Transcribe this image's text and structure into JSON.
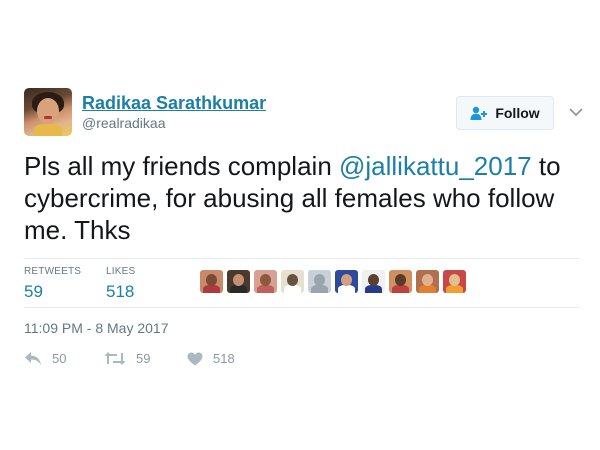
{
  "user": {
    "display_name": "Radikaa Sarathkumar",
    "screen_name": "@realradikaa"
  },
  "follow_button": {
    "label": "Follow",
    "icon": "follow-person-icon"
  },
  "more_menu": {
    "icon": "chevron-down-icon"
  },
  "tweet": {
    "line1_prefix": "Pls all my friends complain ",
    "mention": "@jallikattu_2017",
    "rest": " to cybercrime, for abusing all females who follow me. Thks"
  },
  "stats": {
    "retweets_label": "RETWEETS",
    "retweets_value": "59",
    "likes_label": "LIKES",
    "likes_value": "518"
  },
  "likers": [
    {
      "bg": "#c98a6a",
      "head": "#7a4a34",
      "body": "#b0383e"
    },
    {
      "bg": "#4a3a2e",
      "head": "#c89070",
      "body": "#2a2a2a"
    },
    {
      "bg": "#d8a090",
      "head": "#8a5a40",
      "body": "#c0605a"
    },
    {
      "bg": "#e6e0d0",
      "head": "#6a5040",
      "body": "#ffffff"
    },
    {
      "bg": "#c8d0d8",
      "head": "#9aa4ae",
      "body": "#9aa4ae"
    },
    {
      "bg": "#2e4a9a",
      "head": "#d0a080",
      "body": "#ffffff"
    },
    {
      "bg": "#f0f0f0",
      "head": "#5a4030",
      "body": "#2a3a8a"
    },
    {
      "bg": "#d09060",
      "head": "#5a3a2a",
      "body": "#c04040"
    },
    {
      "bg": "#b07050",
      "head": "#e0b090",
      "body": "#e08030"
    },
    {
      "bg": "#c84848",
      "head": "#e0c090",
      "body": "#f0a030"
    }
  ],
  "timestamp": "11:09 PM - 8 May 2017",
  "actions": {
    "reply": {
      "icon": "reply-icon",
      "count": "50"
    },
    "retweet": {
      "icon": "retweet-icon",
      "count": "59"
    },
    "like": {
      "icon": "heart-icon",
      "count": "518"
    }
  },
  "colors": {
    "link": "#1b7fa8",
    "muted": "#657786",
    "action_icon": "#aab8c2"
  }
}
